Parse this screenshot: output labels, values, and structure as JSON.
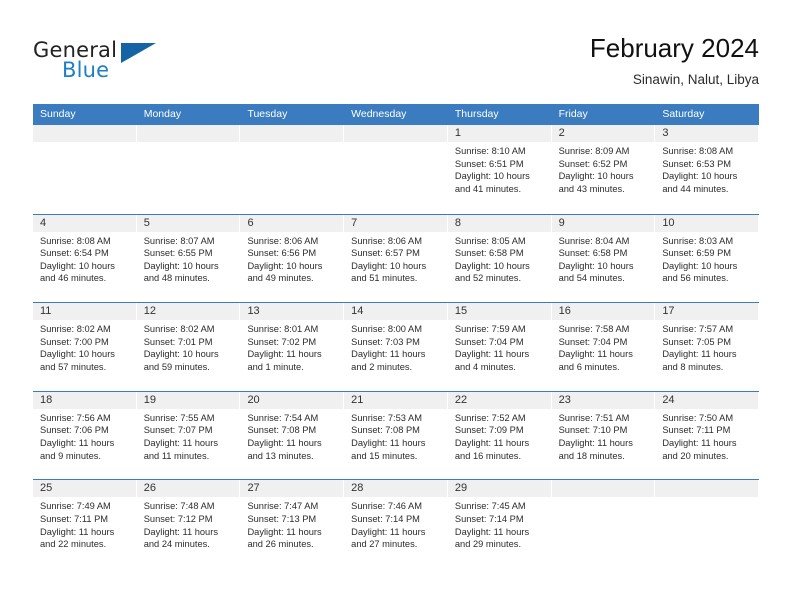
{
  "brand": {
    "word1": "General",
    "word2": "Blue",
    "accent_color": "#1f7fc4",
    "triangle_color": "#1464a5"
  },
  "header": {
    "title": "February 2024",
    "subtitle": "Sinawin, Nalut, Libya"
  },
  "calendar": {
    "header_bg": "#3a7cbf",
    "daynum_bg": "#f0f0f0",
    "weekdays": [
      "Sunday",
      "Monday",
      "Tuesday",
      "Wednesday",
      "Thursday",
      "Friday",
      "Saturday"
    ],
    "weeks": [
      [
        {
          "day": "",
          "empty": true
        },
        {
          "day": "",
          "empty": true
        },
        {
          "day": "",
          "empty": true
        },
        {
          "day": "",
          "empty": true
        },
        {
          "day": "1",
          "sunrise": "Sunrise: 8:10 AM",
          "sunset": "Sunset: 6:51 PM",
          "daylight1": "Daylight: 10 hours",
          "daylight2": "and 41 minutes."
        },
        {
          "day": "2",
          "sunrise": "Sunrise: 8:09 AM",
          "sunset": "Sunset: 6:52 PM",
          "daylight1": "Daylight: 10 hours",
          "daylight2": "and 43 minutes."
        },
        {
          "day": "3",
          "sunrise": "Sunrise: 8:08 AM",
          "sunset": "Sunset: 6:53 PM",
          "daylight1": "Daylight: 10 hours",
          "daylight2": "and 44 minutes."
        }
      ],
      [
        {
          "day": "4",
          "sunrise": "Sunrise: 8:08 AM",
          "sunset": "Sunset: 6:54 PM",
          "daylight1": "Daylight: 10 hours",
          "daylight2": "and 46 minutes."
        },
        {
          "day": "5",
          "sunrise": "Sunrise: 8:07 AM",
          "sunset": "Sunset: 6:55 PM",
          "daylight1": "Daylight: 10 hours",
          "daylight2": "and 48 minutes."
        },
        {
          "day": "6",
          "sunrise": "Sunrise: 8:06 AM",
          "sunset": "Sunset: 6:56 PM",
          "daylight1": "Daylight: 10 hours",
          "daylight2": "and 49 minutes."
        },
        {
          "day": "7",
          "sunrise": "Sunrise: 8:06 AM",
          "sunset": "Sunset: 6:57 PM",
          "daylight1": "Daylight: 10 hours",
          "daylight2": "and 51 minutes."
        },
        {
          "day": "8",
          "sunrise": "Sunrise: 8:05 AM",
          "sunset": "Sunset: 6:58 PM",
          "daylight1": "Daylight: 10 hours",
          "daylight2": "and 52 minutes."
        },
        {
          "day": "9",
          "sunrise": "Sunrise: 8:04 AM",
          "sunset": "Sunset: 6:58 PM",
          "daylight1": "Daylight: 10 hours",
          "daylight2": "and 54 minutes."
        },
        {
          "day": "10",
          "sunrise": "Sunrise: 8:03 AM",
          "sunset": "Sunset: 6:59 PM",
          "daylight1": "Daylight: 10 hours",
          "daylight2": "and 56 minutes."
        }
      ],
      [
        {
          "day": "11",
          "sunrise": "Sunrise: 8:02 AM",
          "sunset": "Sunset: 7:00 PM",
          "daylight1": "Daylight: 10 hours",
          "daylight2": "and 57 minutes."
        },
        {
          "day": "12",
          "sunrise": "Sunrise: 8:02 AM",
          "sunset": "Sunset: 7:01 PM",
          "daylight1": "Daylight: 10 hours",
          "daylight2": "and 59 minutes."
        },
        {
          "day": "13",
          "sunrise": "Sunrise: 8:01 AM",
          "sunset": "Sunset: 7:02 PM",
          "daylight1": "Daylight: 11 hours",
          "daylight2": "and 1 minute."
        },
        {
          "day": "14",
          "sunrise": "Sunrise: 8:00 AM",
          "sunset": "Sunset: 7:03 PM",
          "daylight1": "Daylight: 11 hours",
          "daylight2": "and 2 minutes."
        },
        {
          "day": "15",
          "sunrise": "Sunrise: 7:59 AM",
          "sunset": "Sunset: 7:04 PM",
          "daylight1": "Daylight: 11 hours",
          "daylight2": "and 4 minutes."
        },
        {
          "day": "16",
          "sunrise": "Sunrise: 7:58 AM",
          "sunset": "Sunset: 7:04 PM",
          "daylight1": "Daylight: 11 hours",
          "daylight2": "and 6 minutes."
        },
        {
          "day": "17",
          "sunrise": "Sunrise: 7:57 AM",
          "sunset": "Sunset: 7:05 PM",
          "daylight1": "Daylight: 11 hours",
          "daylight2": "and 8 minutes."
        }
      ],
      [
        {
          "day": "18",
          "sunrise": "Sunrise: 7:56 AM",
          "sunset": "Sunset: 7:06 PM",
          "daylight1": "Daylight: 11 hours",
          "daylight2": "and 9 minutes."
        },
        {
          "day": "19",
          "sunrise": "Sunrise: 7:55 AM",
          "sunset": "Sunset: 7:07 PM",
          "daylight1": "Daylight: 11 hours",
          "daylight2": "and 11 minutes."
        },
        {
          "day": "20",
          "sunrise": "Sunrise: 7:54 AM",
          "sunset": "Sunset: 7:08 PM",
          "daylight1": "Daylight: 11 hours",
          "daylight2": "and 13 minutes."
        },
        {
          "day": "21",
          "sunrise": "Sunrise: 7:53 AM",
          "sunset": "Sunset: 7:08 PM",
          "daylight1": "Daylight: 11 hours",
          "daylight2": "and 15 minutes."
        },
        {
          "day": "22",
          "sunrise": "Sunrise: 7:52 AM",
          "sunset": "Sunset: 7:09 PM",
          "daylight1": "Daylight: 11 hours",
          "daylight2": "and 16 minutes."
        },
        {
          "day": "23",
          "sunrise": "Sunrise: 7:51 AM",
          "sunset": "Sunset: 7:10 PM",
          "daylight1": "Daylight: 11 hours",
          "daylight2": "and 18 minutes."
        },
        {
          "day": "24",
          "sunrise": "Sunrise: 7:50 AM",
          "sunset": "Sunset: 7:11 PM",
          "daylight1": "Daylight: 11 hours",
          "daylight2": "and 20 minutes."
        }
      ],
      [
        {
          "day": "25",
          "sunrise": "Sunrise: 7:49 AM",
          "sunset": "Sunset: 7:11 PM",
          "daylight1": "Daylight: 11 hours",
          "daylight2": "and 22 minutes."
        },
        {
          "day": "26",
          "sunrise": "Sunrise: 7:48 AM",
          "sunset": "Sunset: 7:12 PM",
          "daylight1": "Daylight: 11 hours",
          "daylight2": "and 24 minutes."
        },
        {
          "day": "27",
          "sunrise": "Sunrise: 7:47 AM",
          "sunset": "Sunset: 7:13 PM",
          "daylight1": "Daylight: 11 hours",
          "daylight2": "and 26 minutes."
        },
        {
          "day": "28",
          "sunrise": "Sunrise: 7:46 AM",
          "sunset": "Sunset: 7:14 PM",
          "daylight1": "Daylight: 11 hours",
          "daylight2": "and 27 minutes."
        },
        {
          "day": "29",
          "sunrise": "Sunrise: 7:45 AM",
          "sunset": "Sunset: 7:14 PM",
          "daylight1": "Daylight: 11 hours",
          "daylight2": "and 29 minutes."
        },
        {
          "day": "",
          "empty": true
        },
        {
          "day": "",
          "empty": true
        }
      ]
    ]
  }
}
